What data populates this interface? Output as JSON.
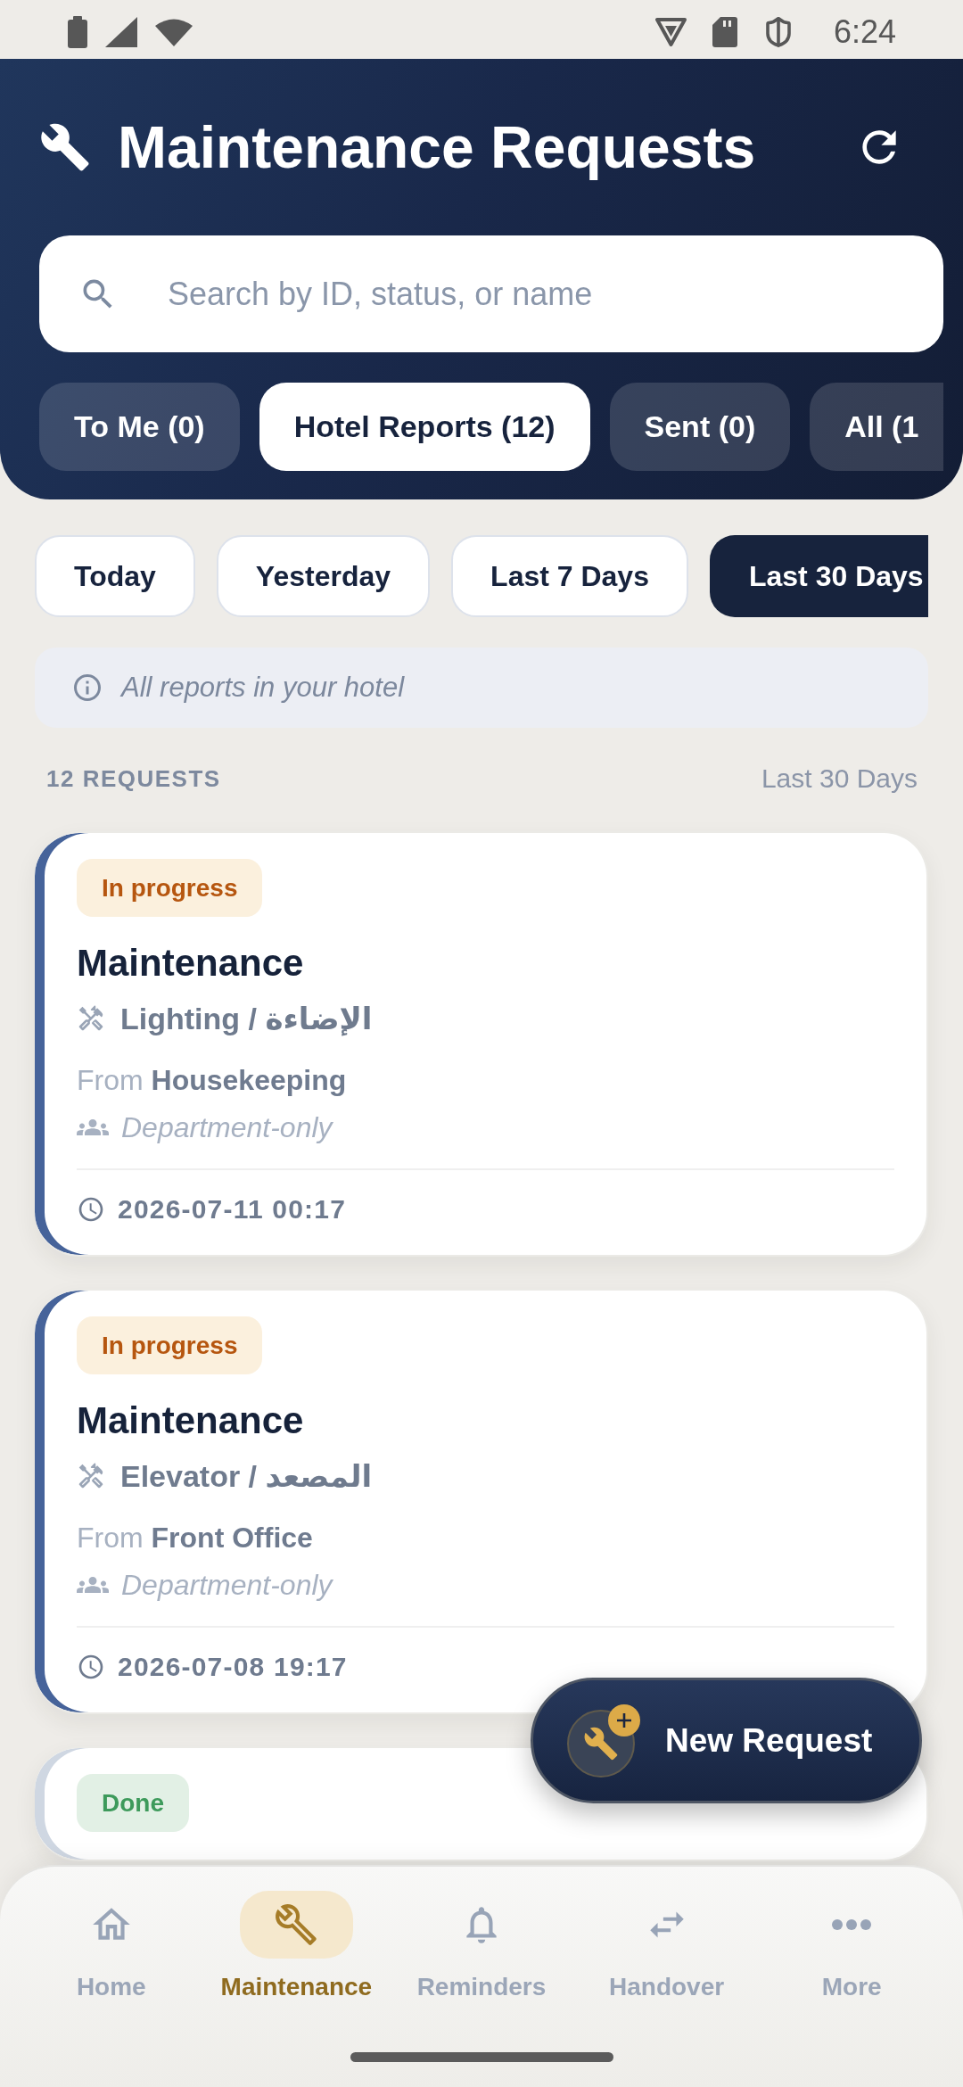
{
  "status_bar": {
    "time": "6:24"
  },
  "header": {
    "title": "Maintenance Requests"
  },
  "search": {
    "placeholder": "Search by ID, status, or name"
  },
  "tabs": [
    {
      "label": "To Me (0)",
      "selected": false
    },
    {
      "label": "Hotel Reports (12)",
      "selected": true
    },
    {
      "label": "Sent (0)",
      "selected": false
    },
    {
      "label": "All (1",
      "selected": false
    }
  ],
  "date_filters": [
    {
      "label": "Today",
      "selected": false
    },
    {
      "label": "Yesterday",
      "selected": false
    },
    {
      "label": "Last 7 Days",
      "selected": false
    },
    {
      "label": "Last 30 Days",
      "selected": true
    }
  ],
  "info_banner": {
    "text": "All reports in your hotel"
  },
  "summary": {
    "count": "12 REQUESTS",
    "range": "Last 30 Days"
  },
  "requests": [
    {
      "status": {
        "label": "In progress",
        "kind": "in_progress"
      },
      "title": "Maintenance",
      "category": "Lighting / الإضاءة",
      "from": "From **Housekeeping**",
      "visibility": "Department-only",
      "timestamp": "2026-07-11 00:17"
    },
    {
      "status": {
        "label": "In progress",
        "kind": "in_progress"
      },
      "title": "Maintenance",
      "category": "Elevator / المصعد",
      "from": "From **Front Office**",
      "visibility": "Department-only",
      "timestamp": "2026-07-08 19:17"
    },
    {
      "status": {
        "label": "Done",
        "kind": "done"
      }
    }
  ],
  "fab": {
    "label": "New Request"
  },
  "bottom_nav": [
    {
      "label": "Home",
      "selected": false
    },
    {
      "label": "Maintenance",
      "selected": true
    },
    {
      "label": "Reminders",
      "selected": false
    },
    {
      "label": "Handover",
      "selected": false
    },
    {
      "label": "More",
      "selected": false
    }
  ]
}
